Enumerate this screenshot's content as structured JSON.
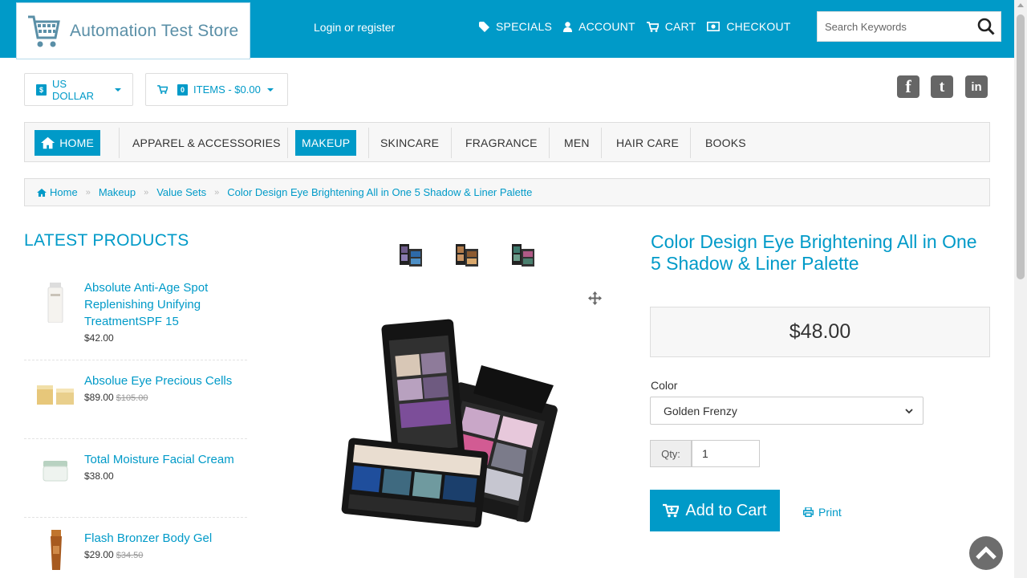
{
  "header": {
    "store_name": "Automation Test Store",
    "login_text": "Login or register",
    "nav": [
      "SPECIALS",
      "ACCOUNT",
      "CART",
      "CHECKOUT"
    ],
    "search_placeholder": "Search Keywords",
    "brand_color": "#009ac8"
  },
  "toolbar": {
    "currency_symbol": "$",
    "currency_label": "US DOLLAR",
    "cart_count": "0",
    "cart_label": "ITEMS - $0.00"
  },
  "social": [
    "facebook-icon",
    "twitter-icon",
    "linkedin-icon"
  ],
  "main_nav": {
    "home": "HOME",
    "items": [
      "APPAREL & ACCESSORIES",
      "MAKEUP",
      "SKINCARE",
      "FRAGRANCE",
      "MEN",
      "HAIR CARE",
      "BOOKS"
    ],
    "active": "MAKEUP"
  },
  "breadcrumb": [
    "Home",
    "Makeup",
    "Value Sets",
    "Color Design Eye Brightening All in One 5 Shadow & Liner Palette"
  ],
  "latest": {
    "title": "LATEST PRODUCTS",
    "items": [
      {
        "name": "Absolute Anti-Age Spot Replenishing Unifying TreatmentSPF 15",
        "price": "$42.00",
        "old_price": ""
      },
      {
        "name": "Absolue Eye Precious Cells",
        "price": "$89.00",
        "old_price": "$105.00"
      },
      {
        "name": "Total Moisture Facial Cream",
        "price": "$38.00",
        "old_price": ""
      },
      {
        "name": "Flash Bronzer Body Gel",
        "price": "$29.00",
        "old_price": "$34.50"
      }
    ]
  },
  "product": {
    "title": "Color Design Eye Brightening All in One 5 Shadow & Liner Palette",
    "price": "$48.00",
    "color_label": "Color",
    "color_value": "Golden Frenzy",
    "qty_label": "Qty:",
    "qty_value": "1",
    "add_to_cart": "Add to Cart",
    "print": "Print"
  }
}
